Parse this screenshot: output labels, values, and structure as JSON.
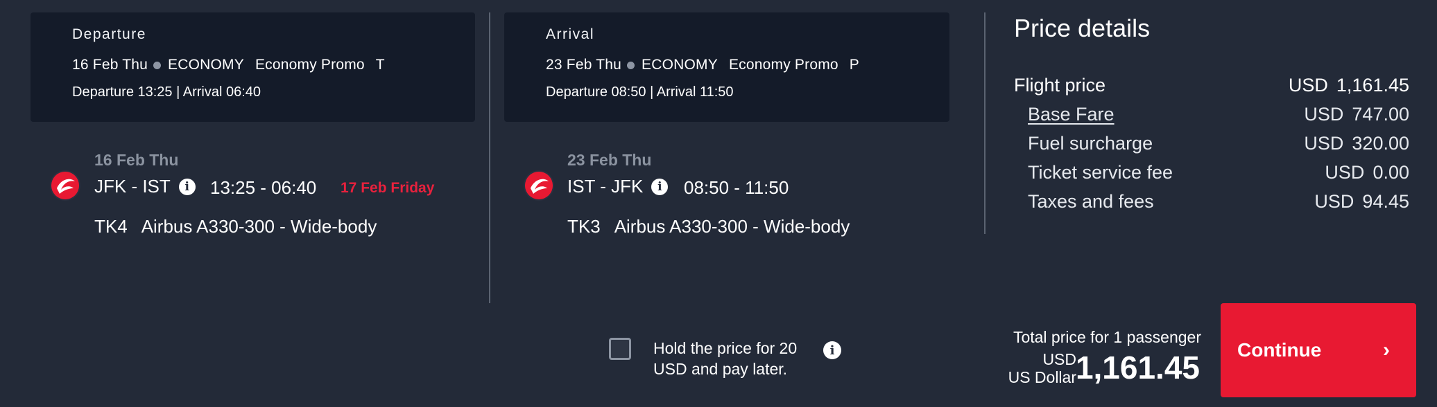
{
  "departure_card": {
    "title": "Departure",
    "date": "16 Feb Thu",
    "cabin": "ECONOMY",
    "fare": "Economy Promo",
    "fare_class": "T",
    "times": "Departure 13:25 | Arrival 06:40"
  },
  "arrival_card": {
    "title": "Arrival",
    "date": "23 Feb Thu",
    "cabin": "ECONOMY",
    "fare": "Economy Promo",
    "fare_class": "P",
    "times": "Departure 08:50 | Arrival 11:50"
  },
  "outbound": {
    "date": "16 Feb Thu",
    "route": "JFK - IST",
    "time": "13:25 - 06:40",
    "next_day": "17 Feb Friday",
    "flight_no": "TK4",
    "aircraft": "Airbus A330-300 - Wide-body"
  },
  "inbound": {
    "date": "23 Feb Thu",
    "route": "IST - JFK",
    "time": "08:50 - 11:50",
    "flight_no": "TK3",
    "aircraft": "Airbus A330-300 - Wide-body"
  },
  "price_details": {
    "title": "Price details",
    "rows": [
      {
        "label": "Flight price",
        "currency": "USD",
        "amount": "1,161.45"
      },
      {
        "label": "Base Fare",
        "currency": "USD",
        "amount": "747.00"
      },
      {
        "label": "Fuel surcharge",
        "currency": "USD",
        "amount": "320.00"
      },
      {
        "label": "Ticket service fee",
        "currency": "USD",
        "amount": "0.00"
      },
      {
        "label": "Taxes and fees",
        "currency": "USD",
        "amount": "94.45"
      }
    ]
  },
  "hold": {
    "line1": "Hold the price for 20",
    "line2": "USD and pay later."
  },
  "total": {
    "label": "Total price for 1 passenger",
    "currency_code": "USD",
    "currency_name": "US Dollar",
    "amount": "1,161.45"
  },
  "continue_label": "Continue",
  "icons": {
    "info": "info-icon",
    "chevron": "chevron-right-icon",
    "logo": "turkish-airlines-logo"
  },
  "colors": {
    "accent": "#e81932",
    "background": "#232a38",
    "card": "#141b29",
    "next_day": "#e8213d"
  }
}
